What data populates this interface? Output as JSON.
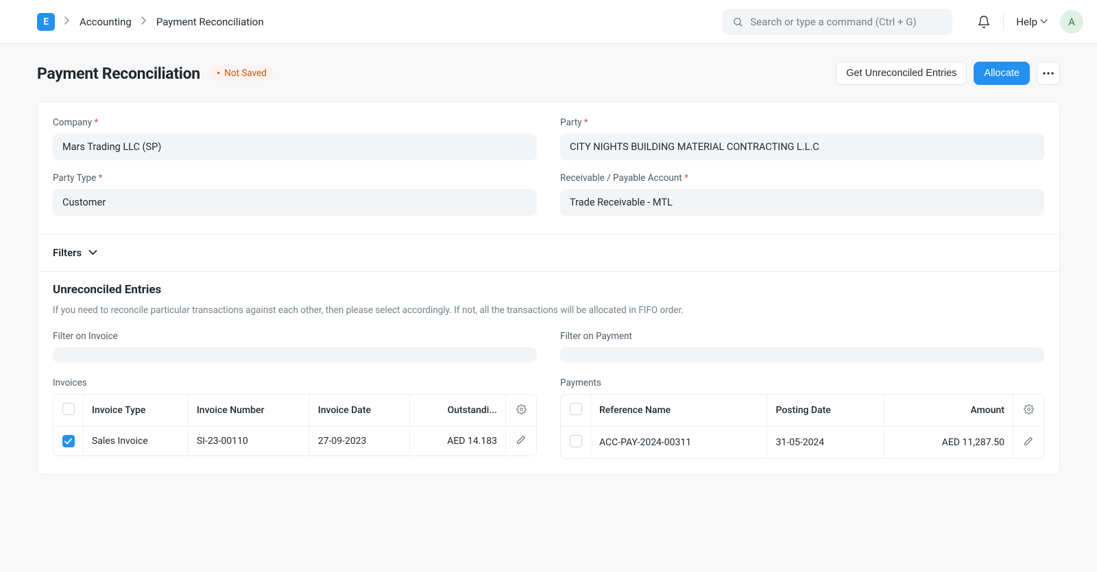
{
  "nav": {
    "logo_letter": "E",
    "breadcrumbs": [
      "Accounting",
      "Payment Reconciliation"
    ],
    "search_placeholder": "Search or type a command (Ctrl + G)",
    "help_label": "Help",
    "avatar_letter": "A"
  },
  "header": {
    "title": "Payment Reconciliation",
    "status": "Not Saved",
    "get_unreconciled_label": "Get Unreconciled Entries",
    "allocate_label": "Allocate"
  },
  "form": {
    "company_label": "Company",
    "company_value": "Mars Trading LLC (SP)",
    "party_label": "Party",
    "party_value": "CITY NIGHTS BUILDING MATERIAL CONTRACTING L.L.C",
    "party_type_label": "Party Type",
    "party_type_value": "Customer",
    "account_label": "Receivable / Payable Account",
    "account_value": "Trade Receivable - MTL"
  },
  "filters_label": "Filters",
  "unreconciled": {
    "title": "Unreconciled Entries",
    "help": "If you need to reconcile particular transactions against each other, then please select accordingly. If not, all the transactions will be allocated in FIFO order.",
    "filter_invoice_label": "Filter on Invoice",
    "filter_payment_label": "Filter on Payment",
    "invoices_label": "Invoices",
    "payments_label": "Payments",
    "inv_cols": {
      "type": "Invoice Type",
      "number": "Invoice Number",
      "date": "Invoice Date",
      "outstanding": "Outstandi..."
    },
    "inv_rows": [
      {
        "checked": true,
        "type": "Sales Invoice",
        "number": "SI-23-00110",
        "date": "27-09-2023",
        "outstanding": "AED 14.183"
      }
    ],
    "pay_cols": {
      "ref": "Reference Name",
      "date": "Posting Date",
      "amount": "Amount"
    },
    "pay_rows": [
      {
        "checked": false,
        "ref": "ACC-PAY-2024-00311",
        "date": "31-05-2024",
        "amount": "AED 11,287.50"
      }
    ]
  }
}
